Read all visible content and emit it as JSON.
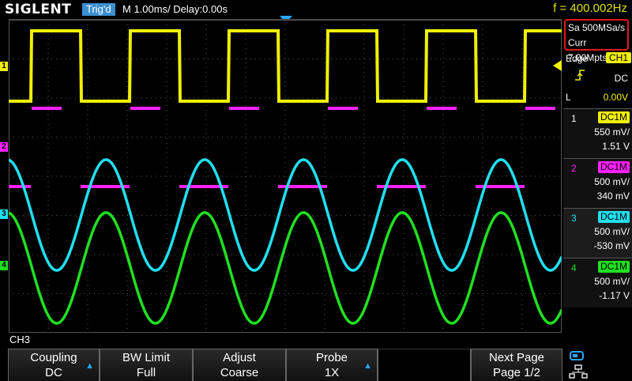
{
  "header": {
    "logo": "SIGLENT",
    "trigger_status": "Trig'd",
    "timebase": "M 1.00ms/ Delay:0.00s",
    "frequency": "f = 400.002Hz"
  },
  "acquisition": {
    "sample_rate": "Sa 500MSa/s",
    "memory": "Curr 7.00Mpts"
  },
  "trigger": {
    "type": "Edge",
    "source": "CH1",
    "coupling": "DC",
    "level_label": "L",
    "level": "0.00V"
  },
  "channels": [
    {
      "num": "1",
      "tag": "DC1M",
      "scale": "550 mV/",
      "offset": "1.51 V",
      "color": "#f0f000"
    },
    {
      "num": "2",
      "tag": "DC1M",
      "scale": "500 mV/",
      "offset": "340 mV",
      "color": "#ff20ff"
    },
    {
      "num": "3",
      "tag": "DC1M",
      "scale": "500 mV/",
      "offset": "-530 mV",
      "color": "#20e0f0"
    },
    {
      "num": "4",
      "tag": "DC1M",
      "scale": "500 mV/",
      "offset": "-1.17 V",
      "color": "#20e020"
    }
  ],
  "markers": [
    "1",
    "2",
    "3",
    "4"
  ],
  "active_channel": "CH3",
  "softkeys": {
    "coupling": {
      "title": "Coupling",
      "value": "DC"
    },
    "bw_limit": {
      "title": "BW Limit",
      "value": "Full"
    },
    "adjust": {
      "title": "Adjust",
      "value": "Coarse"
    },
    "probe": {
      "title": "Probe",
      "value": "1X"
    },
    "next_page": {
      "title": "Next Page",
      "value": "Page 1/2"
    }
  }
}
